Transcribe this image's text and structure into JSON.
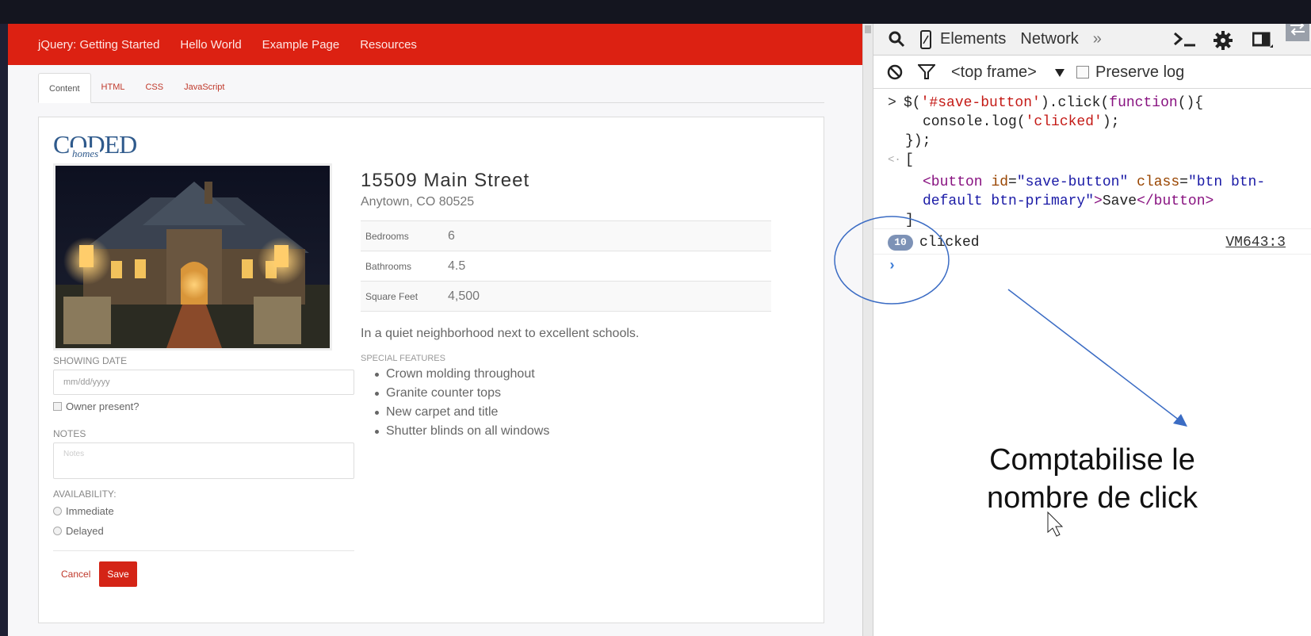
{
  "navbar": {
    "items": [
      "jQuery: Getting Started",
      "Hello World",
      "Example Page",
      "Resources"
    ]
  },
  "tabs": [
    "Content",
    "HTML",
    "CSS",
    "JavaScript"
  ],
  "logo": {
    "big": "CODED",
    "small": "homes"
  },
  "listing": {
    "street": "15509 Main Street",
    "city": "Anytown, CO 80525",
    "specs": [
      {
        "key": "Bedrooms",
        "value": "6"
      },
      {
        "key": "Bathrooms",
        "value": "4.5"
      },
      {
        "key": "Square Feet",
        "value": "4,500"
      }
    ],
    "description": "In a quiet neighborhood next to excellent schools.",
    "features_title": "SPECIAL FEATURES",
    "features": [
      "Crown molding throughout",
      "Granite counter tops",
      "New carpet and title",
      "Shutter blinds on all windows"
    ]
  },
  "form": {
    "showing_date_label": "SHOWING DATE",
    "showing_date_placeholder": "mm/dd/yyyy",
    "owner_present_label": "Owner present?",
    "notes_label": "NOTES",
    "notes_placeholder": "Notes",
    "availability_label": "AVAILABILITY:",
    "availability_options": [
      "Immediate",
      "Delayed"
    ],
    "cancel_label": "Cancel",
    "save_label": "Save"
  },
  "devtools": {
    "tabs": [
      "Elements",
      "Network",
      "»"
    ],
    "frame_selector": "<top frame>",
    "preserve_log_label": "Preserve log",
    "console": {
      "code_line1_a": "$(",
      "code_line1_str": "'#save-button'",
      "code_line1_b": ").click(",
      "code_line1_kw": "function",
      "code_line1_c": "(){",
      "code_line2_a": "console.log(",
      "code_line2_str": "'clicked'",
      "code_line2_b": ");",
      "code_line3": "});",
      "result_open": "[",
      "html_line1_tag": "<button",
      "html_line1_attr1": "id",
      "html_line1_val1": "\"save-button\"",
      "html_line1_attr2": "class",
      "html_line1_val2": "\"btn btn-",
      "html_line2_val": "default btn-primary\"",
      "html_line2_tag_close": ">",
      "html_line2_text": "Save",
      "html_line2_end": "</button>",
      "result_close": "]",
      "log_count": "10",
      "log_text": "clicked",
      "log_source": "VM643:3"
    }
  },
  "annotation": {
    "line1": "Comptabilise le",
    "line2": "nombre de click",
    "color": "#3b6cc4"
  },
  "colors": {
    "navbar": "#dc2112",
    "save_button": "#d42416"
  }
}
